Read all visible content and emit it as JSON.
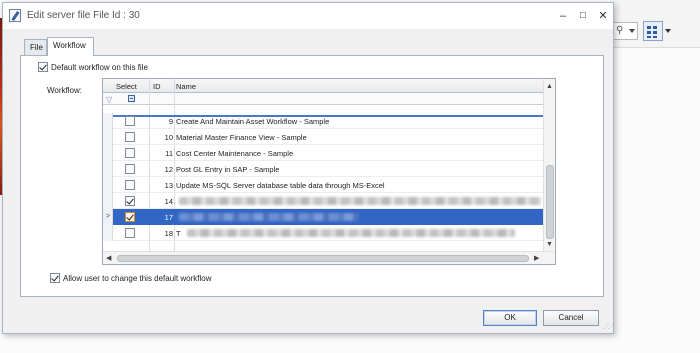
{
  "dialog": {
    "title": "Edit server file File Id : 30",
    "controls": {
      "minimize": "–",
      "maximize": "□",
      "close": "✕"
    }
  },
  "tabs": [
    {
      "label": "File",
      "active": false
    },
    {
      "label": "Workflow",
      "active": true
    }
  ],
  "workflow_tab": {
    "default_checkbox_label": "Default workflow on this file",
    "default_checked": true,
    "field_label": "Workflow:",
    "allow_change_label": "Allow user to change this default workflow",
    "allow_change_checked": true
  },
  "grid": {
    "columns": {
      "select": "Select",
      "id": "ID",
      "name": "Name"
    },
    "filter_icon": "funnel-icon",
    "rows": [
      {
        "id": "9",
        "name": "Create And Maintain Asset Workflow - Sample",
        "checked": false,
        "selected": false,
        "blurred": false
      },
      {
        "id": "10",
        "name": "Material Master Finance View - Sample",
        "checked": false,
        "selected": false,
        "blurred": false
      },
      {
        "id": "11",
        "name": "Cost Center Maintenance - Sample",
        "checked": false,
        "selected": false,
        "blurred": false
      },
      {
        "id": "12",
        "name": "Post GL Entry in SAP - Sample",
        "checked": false,
        "selected": false,
        "blurred": false
      },
      {
        "id": "13",
        "name": "Update MS-SQL Server database table data through MS-Excel",
        "checked": false,
        "selected": false,
        "blurred": false
      },
      {
        "id": "14",
        "name": "",
        "checked": true,
        "selected": false,
        "blurred": true
      },
      {
        "id": "17",
        "name": "",
        "checked": true,
        "selected": true,
        "blurred": true
      },
      {
        "id": "18",
        "name": "T",
        "checked": false,
        "selected": false,
        "blurred": true
      }
    ]
  },
  "buttons": {
    "ok": "OK",
    "cancel": "Cancel"
  },
  "colors": {
    "selection": "#3166c4",
    "accent": "#4a77c4",
    "dialog_bg": "#f0f0f0"
  },
  "background": {
    "search_icon": "search-icon",
    "grid_view_icon": "grid-view-icon"
  }
}
